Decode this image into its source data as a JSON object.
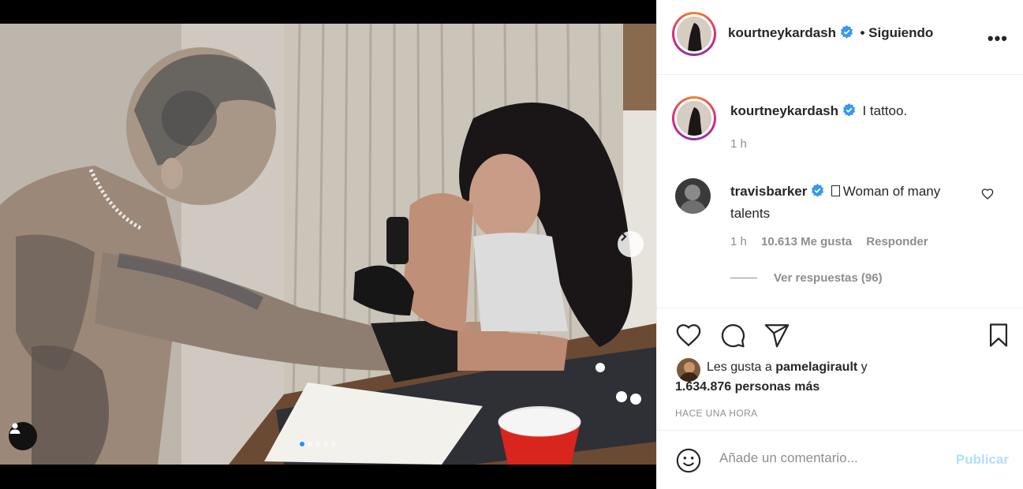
{
  "post": {
    "author": "kourtneykardash",
    "follow_status": "• Siguiendo",
    "more_label": "•••"
  },
  "caption": {
    "author": "kourtneykardash",
    "text": "I tattoo.",
    "time": "1 h"
  },
  "comment": {
    "author": "travisbarker",
    "text": "Woman of many talents",
    "time": "1 h",
    "likes": "10.613 Me gusta",
    "reply_label": "Responder",
    "view_replies": "Ver respuestas (96)"
  },
  "likes": {
    "prefix": "Les gusta a",
    "user": "pamelagirault",
    "connector": "y",
    "others": "1.634.876 personas más"
  },
  "timestamp": "HACE UNA HORA",
  "comment_input": {
    "placeholder": "Añade un comentario..."
  },
  "publish_label": "Publicar",
  "carousel": {
    "count": 5,
    "active": 1
  },
  "colors": {
    "accent": "#0095f6",
    "verified": "#3897f0",
    "publish_disabled": "#b2dffc"
  },
  "icons": [
    "heart-icon",
    "comment-icon",
    "share-icon",
    "bookmark-icon",
    "emoji-icon",
    "chevron-right-icon",
    "user-tag-icon",
    "verified-badge-icon"
  ]
}
